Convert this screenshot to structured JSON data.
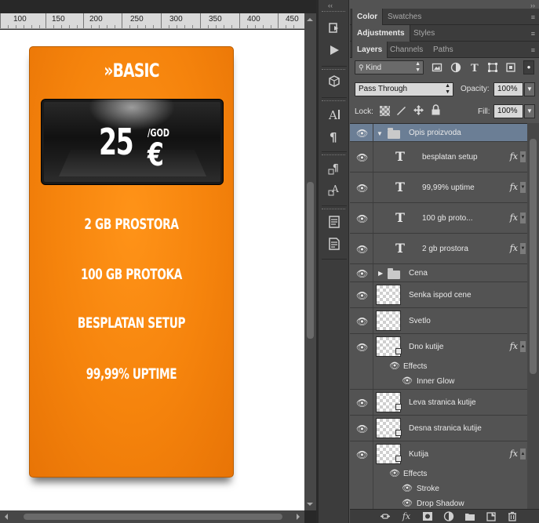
{
  "ruler": {
    "labels": [
      "100",
      "150",
      "200",
      "250",
      "300",
      "350",
      "400",
      "450"
    ]
  },
  "card": {
    "title": "»BASIC",
    "price": {
      "amount": "25",
      "currency": "€",
      "period": "/GOD"
    },
    "features": [
      "2 GB PROSTORA",
      "100 GB PROTOKA",
      "BESPLATAN SETUP",
      "99,99% UPTIME"
    ],
    "color": "#f5830c"
  },
  "tool_strip": {
    "collapse_glyph": "‹‹",
    "icons": [
      "history-icon",
      "play-actions-icon",
      "3d-cube-icon",
      "character-icon",
      "paragraph-icon",
      "paragraph-styles-icon",
      "character-styles-icon",
      "notes-icon",
      "info-icon"
    ]
  },
  "panels": {
    "collapse_glyph": "››",
    "group1": {
      "tabs": [
        "Color",
        "Swatches"
      ]
    },
    "group2": {
      "tabs": [
        "Adjustments",
        "Styles"
      ]
    },
    "group3": {
      "tabs": [
        "Layers",
        "Channels",
        "Paths"
      ]
    },
    "menu_glyph": "≡"
  },
  "layers_panel": {
    "filter_kind": "Kind",
    "blend_mode": "Pass Through",
    "opacity_label": "Opacity:",
    "opacity_value": "100%",
    "lock_label": "Lock:",
    "fill_label": "Fill:",
    "fill_value": "100%",
    "selected_color": "#6b7e95",
    "layers": [
      {
        "type": "group",
        "name": "Opis proizvoda",
        "expanded": true,
        "selected": true
      },
      {
        "type": "text",
        "name": "besplatan        setup",
        "fx": true
      },
      {
        "type": "text",
        "name": "99,99%      uptime",
        "fx": true
      },
      {
        "type": "text",
        "name": "100      gb          proto...",
        "fx": true
      },
      {
        "type": "text",
        "name": "2      gb          prostora",
        "fx": true
      },
      {
        "type": "group",
        "name": "Cena",
        "expanded": false
      },
      {
        "type": "pixel",
        "name": "Senka ispod cene"
      },
      {
        "type": "pixel",
        "name": "Svetlo"
      },
      {
        "type": "pixel",
        "name": "Dno kutije",
        "fx": true,
        "effects_label": "Effects",
        "effects": [
          "Inner Glow"
        ]
      },
      {
        "type": "pixel",
        "name": "Leva stranica kutije"
      },
      {
        "type": "pixel",
        "name": "Desna stranica kutije"
      },
      {
        "type": "pixel",
        "name": "Kutija",
        "fx": true,
        "effects_label": "Effects",
        "effects": [
          "Stroke",
          "Drop Shadow"
        ]
      }
    ],
    "fx_label": "fx",
    "footer_icons": [
      "link-layers-icon",
      "add-style-icon",
      "add-mask-icon",
      "adjustment-layer-icon",
      "new-group-icon",
      "new-layer-icon",
      "delete-layer-icon"
    ]
  }
}
